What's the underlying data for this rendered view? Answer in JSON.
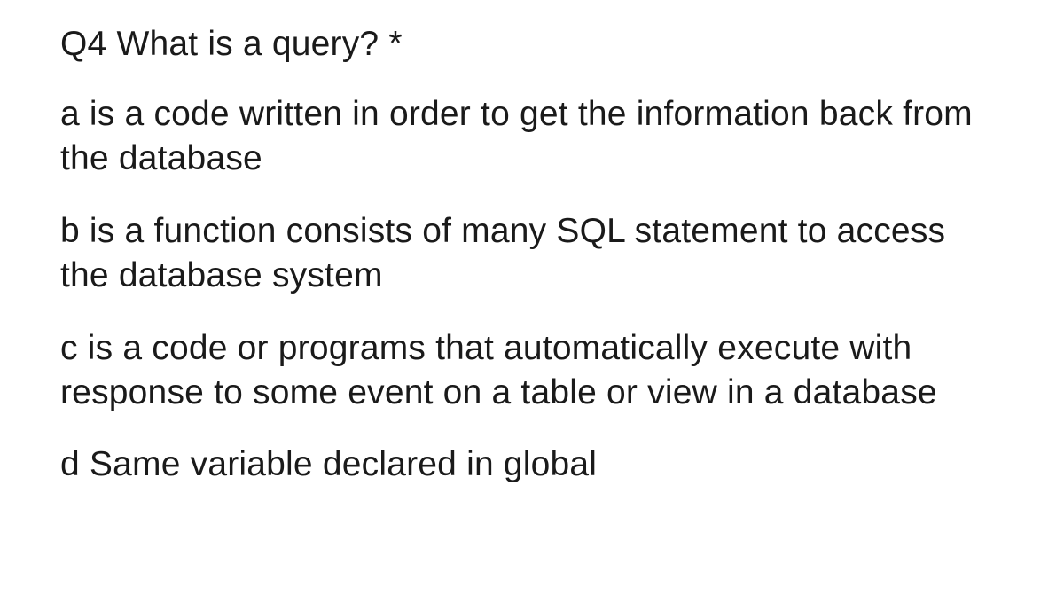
{
  "question": {
    "title": "Q4 What is a query? *",
    "options": [
      "a is a code written in order to get the information back from the database",
      "b is a function consists of many SQL statement to access the database system",
      "c is a code or programs that automatically execute with response to some event on a table or view in a database",
      "d Same variable declared in global"
    ]
  }
}
